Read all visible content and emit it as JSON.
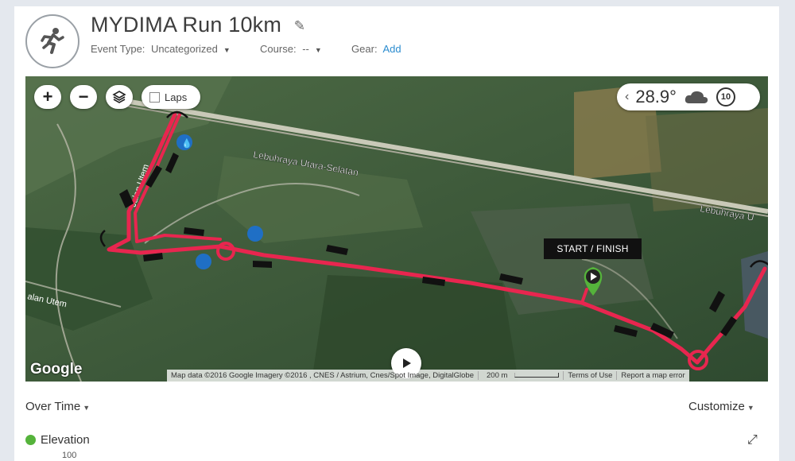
{
  "activity": {
    "title": "MYDIMA Run 10km",
    "event_type_label": "Event Type:",
    "event_type_value": "Uncategorized",
    "course_label": "Course:",
    "course_value": "--",
    "gear_label": "Gear:",
    "gear_action": "Add",
    "icon": "running-person-icon"
  },
  "map": {
    "controls": {
      "zoom_in": "+",
      "zoom_out": "−",
      "laps_label": "Laps"
    },
    "weather": {
      "temperature": "28.9°",
      "condition_icon": "cloud-icon",
      "wind": "10"
    },
    "road_labels": [
      "Lebuhraya Utara-Selatan",
      "Lebuhraya U",
      "Jalan Utem",
      "alan Utem"
    ],
    "start_finish_label": "START / FINISH",
    "google_logo": "Google",
    "attribution": "Map data ©2016 Google Imagery ©2016 , CNES / Astrium, Cnes/Spot Image, DigitalGlobe",
    "scale": "200 m",
    "terms": "Terms of Use",
    "report": "Report a map error",
    "route_color": "#e8264f"
  },
  "chart_controls": {
    "over_time": "Over Time",
    "customize": "Customize",
    "series_label": "Elevation",
    "series_color": "#55b33b",
    "y_tick_top": "100"
  }
}
